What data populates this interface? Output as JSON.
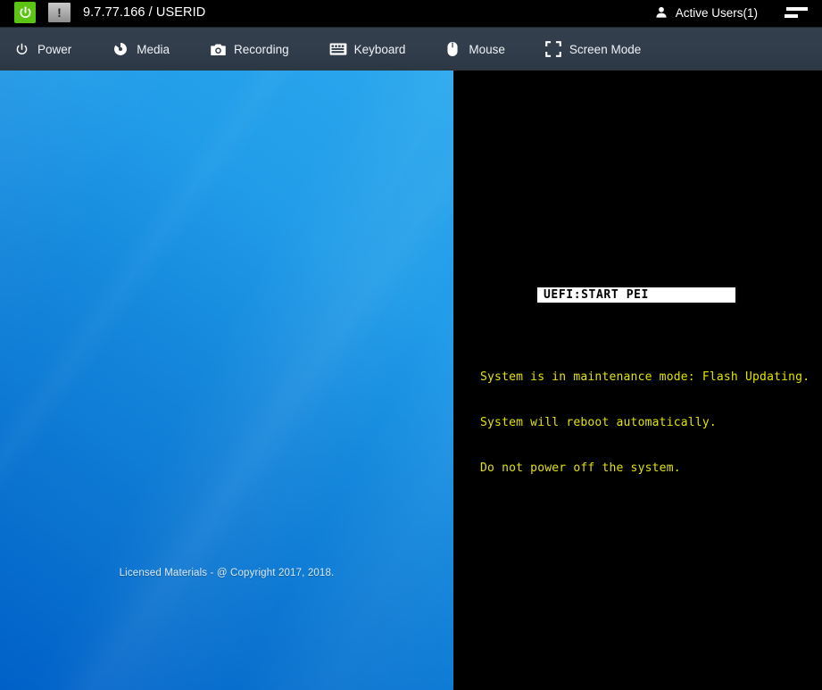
{
  "titlebar": {
    "power_icon": "power-icon",
    "warning_icon": "warning-icon",
    "warning_glyph": "!",
    "host": "9.7.77.166 / USERID",
    "active_users": "Active Users(1)",
    "user_icon": "user-icon",
    "menu_icon": "hamburger-menu-icon"
  },
  "toolbar": {
    "items": [
      {
        "label": "Power",
        "icon": "power-icon"
      },
      {
        "label": "Media",
        "icon": "disc-icon"
      },
      {
        "label": "Recording",
        "icon": "camera-icon"
      },
      {
        "label": "Keyboard",
        "icon": "keyboard-icon"
      },
      {
        "label": "Mouse",
        "icon": "mouse-icon"
      },
      {
        "label": "Screen Mode",
        "icon": "fullscreen-icon"
      }
    ]
  },
  "splash": {
    "copyright": "Licensed Materials - @ Copyright  2017, 2018."
  },
  "console": {
    "status_box": "UEFI:START PEI",
    "messages": [
      "System is in maintenance mode: Flash Updating.",
      "System will reboot automatically.",
      "Do not power off the system."
    ]
  },
  "colors": {
    "accent_green": "#5cc413",
    "toolbar_bg": "#313d4b",
    "splash_blue_dark": "#0060c8",
    "splash_blue_light": "#2aa8ee",
    "bios_yellow": "#e3e300",
    "console_bg": "#000000"
  }
}
